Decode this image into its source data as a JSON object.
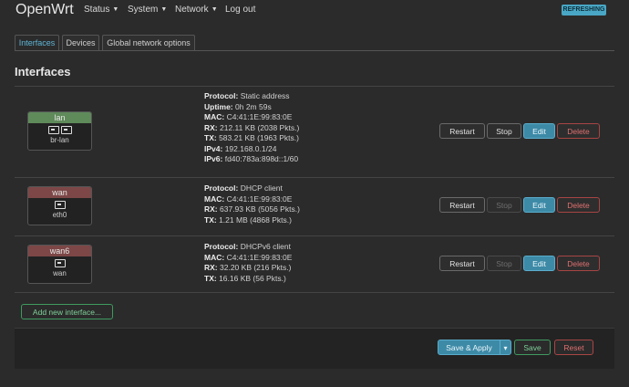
{
  "header": {
    "brand": "OpenWrt",
    "menu": [
      "Status",
      "System",
      "Network",
      "Log out"
    ],
    "badge": "REFRESHING"
  },
  "tabs": [
    "Interfaces",
    "Devices",
    "Global network options"
  ],
  "page_title": "Interfaces",
  "interfaces": [
    {
      "name": "lan",
      "device": "br-lan",
      "color": "#5f8a5a",
      "info": [
        [
          "Protocol:",
          "Static address"
        ],
        [
          "Uptime:",
          "0h 2m 59s"
        ],
        [
          "MAC:",
          "C4:41:1E:99:83:0E"
        ],
        [
          "RX:",
          "212.11 KB (2038 Pkts.)"
        ],
        [
          "TX:",
          "583.21 KB (1963 Pkts.)"
        ],
        [
          "IPv4:",
          "192.168.0.1/24"
        ],
        [
          "IPv6:",
          "fd40:783a:898d::1/60"
        ]
      ],
      "stop_enabled": true
    },
    {
      "name": "wan",
      "device": "eth0",
      "color": "#7d4747",
      "info": [
        [
          "Protocol:",
          "DHCP client"
        ],
        [
          "MAC:",
          "C4:41:1E:99:83:0E"
        ],
        [
          "RX:",
          "637.93 KB (5056 Pkts.)"
        ],
        [
          "TX:",
          "1.21 MB (4868 Pkts.)"
        ]
      ],
      "stop_enabled": false
    },
    {
      "name": "wan6",
      "device": "wan",
      "color": "#7d4747",
      "info": [
        [
          "Protocol:",
          "DHCPv6 client"
        ],
        [
          "MAC:",
          "C4:41:1E:99:83:0E"
        ],
        [
          "RX:",
          "32.20 KB (216 Pkts.)"
        ],
        [
          "TX:",
          "16.16 KB (56 Pkts.)"
        ]
      ],
      "stop_enabled": false
    }
  ],
  "row_buttons": {
    "restart": "Restart",
    "stop": "Stop",
    "edit": "Edit",
    "delete": "Delete"
  },
  "add_button": "Add new interface...",
  "footer": {
    "save_apply": "Save & Apply",
    "caret": "▾",
    "save": "Save",
    "reset": "Reset"
  }
}
